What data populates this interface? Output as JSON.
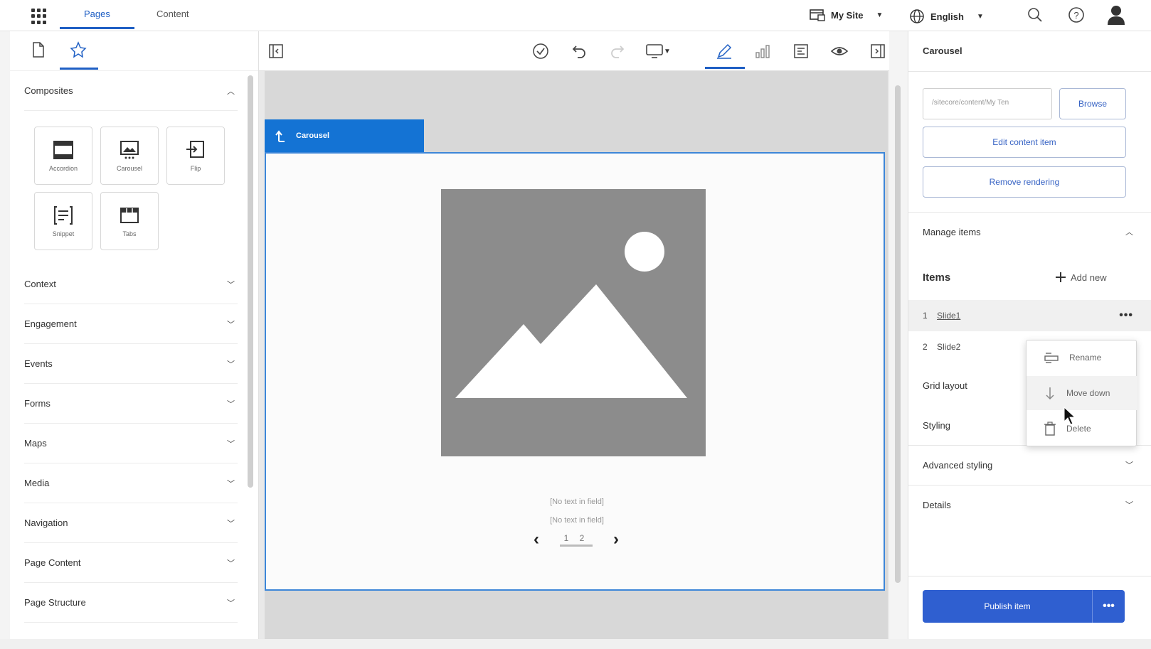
{
  "topbar": {
    "tabs": [
      {
        "label": "Pages",
        "active": true
      },
      {
        "label": "Content",
        "active": false
      }
    ],
    "site_selector": "My Site",
    "language_selector": "English",
    "icons": [
      "apps-grid-icon",
      "search-icon",
      "help-icon",
      "user-avatar-icon"
    ]
  },
  "left_panel": {
    "composites": {
      "title": "Composites",
      "tiles": [
        "Accordion",
        "Carousel",
        "Flip",
        "Snippet",
        "Tabs"
      ]
    },
    "sections": [
      "Context",
      "Engagement",
      "Events",
      "Forms",
      "Maps",
      "Media",
      "Navigation",
      "Page Content",
      "Page Structure"
    ]
  },
  "canvas": {
    "chip_label": "Carousel",
    "no_text_1": "[No text in field]",
    "no_text_2": "[No text in field]",
    "pager_pages": "1 2"
  },
  "right_panel": {
    "title": "Carousel",
    "path_value": "/sitecore/content/My Ten",
    "browse_label": "Browse",
    "edit_content_item_label": "Edit content item",
    "remove_rendering_label": "Remove rendering",
    "manage_items_label": "Manage items",
    "items_label": "Items",
    "add_new_label": "Add new",
    "items": [
      {
        "num": "1",
        "name": "Slide1",
        "selected": true
      },
      {
        "num": "2",
        "name": "Slide2",
        "selected": false
      }
    ],
    "grid_layout_label": "Grid layout",
    "styling_label": "Styling",
    "advanced_styling_label": "Advanced styling",
    "details_label": "Details",
    "publish_label": "Publish item",
    "context_menu": [
      "Rename",
      "Move down",
      "Delete"
    ]
  },
  "colors": {
    "accent": "#1f5fc4",
    "chip": "#1473d4",
    "publish": "#2f5fd0",
    "placeholder": "#8c8c8c"
  }
}
